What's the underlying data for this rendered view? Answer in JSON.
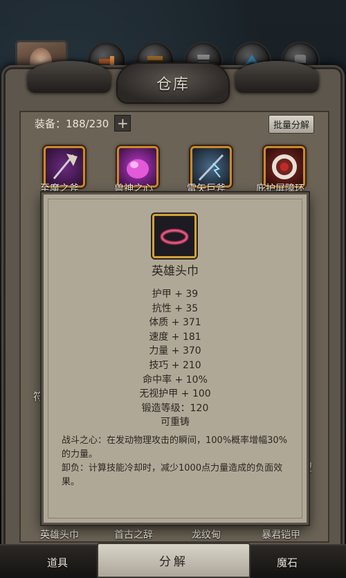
{
  "header": {
    "title": "仓库",
    "tabs": [
      {
        "icon": "weapon-icon"
      },
      {
        "icon": "chest-icon"
      },
      {
        "icon": "armor-icon"
      },
      {
        "icon": "wing-icon"
      },
      {
        "icon": "gauntlet-icon"
      }
    ]
  },
  "status": {
    "equip_label": "装备：188/230",
    "add_label": "+",
    "bulk_decompose_label": "批量分解"
  },
  "items_row1": [
    {
      "name": "至魔之斧",
      "icon": "axe-icon"
    },
    {
      "name": "兽神之心",
      "icon": "beast-heart-icon"
    },
    {
      "name": "雷矢巨斧",
      "icon": "thunder-axe-icon"
    },
    {
      "name": "庇护屏障环",
      "icon": "ring-icon"
    }
  ],
  "side_labels": {
    "left": "符",
    "right": "望"
  },
  "items_row_bottom": [
    {
      "name": "英雄头巾"
    },
    {
      "name": "首古之辞"
    },
    {
      "name": "龙纹甸"
    },
    {
      "name": "暴君铠甲"
    }
  ],
  "tooltip": {
    "name": "英雄头巾",
    "stats": [
      "护甲 + 39",
      "抗性 + 35",
      "体质 + 371",
      "速度 + 181",
      "力量 + 370",
      "技巧 + 210",
      "命中率 + 10%",
      "无视护甲 + 100",
      "锻造等级：120",
      "可重铸"
    ],
    "description_1": "战斗之心：在发动物理攻击的瞬间，100%概率增幅30%的力量。",
    "description_2": "卸负：计算技能冷却时，减少1000点力量造成的负面效果。"
  },
  "bottom": {
    "tab_items": "道具",
    "decompose": "分解",
    "tab_magic_stone": "魔石"
  }
}
